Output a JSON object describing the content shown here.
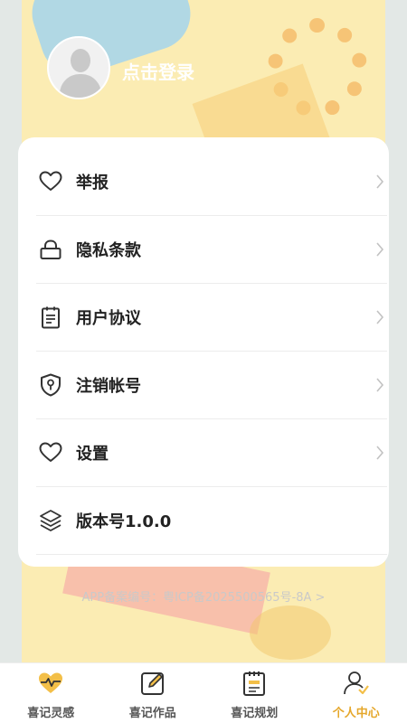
{
  "header": {
    "login_text": "点击登录"
  },
  "menu": {
    "items": [
      {
        "label": "举报",
        "icon": "heart-icon"
      },
      {
        "label": "隐私条款",
        "icon": "lock-icon"
      },
      {
        "label": "用户协议",
        "icon": "clipboard-icon"
      },
      {
        "label": "注销帐号",
        "icon": "shield-icon"
      },
      {
        "label": "设置",
        "icon": "heart-icon"
      },
      {
        "label": "版本号1.0.0",
        "icon": "layers-icon"
      }
    ]
  },
  "footer": {
    "icp": "APP备案编号：粤ICP备2025500565号-8A >"
  },
  "bottom_nav": {
    "tabs": [
      {
        "label": "喜记灵感",
        "icon": "heartbeat-icon"
      },
      {
        "label": "喜记作品",
        "icon": "edit-icon"
      },
      {
        "label": "喜记规划",
        "icon": "notepad-icon"
      },
      {
        "label": "个人中心",
        "icon": "user-icon",
        "active": true
      }
    ]
  },
  "colors": {
    "accent": "#e5a72b",
    "card_bg": "#ffffff",
    "page_bg": "#fbecb3"
  }
}
